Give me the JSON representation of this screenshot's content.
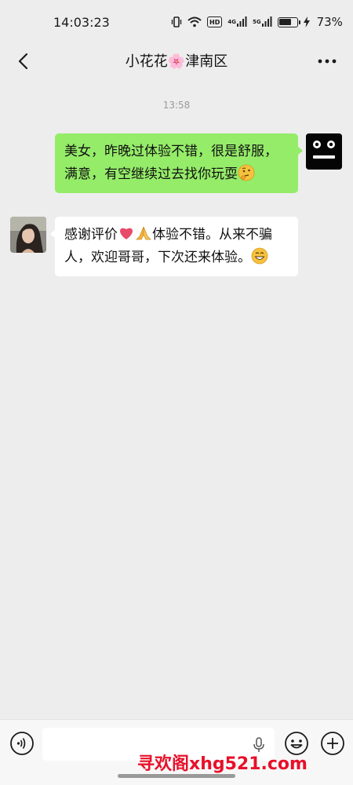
{
  "status_bar": {
    "time": "14:03:23",
    "hd_label": "HD",
    "net1_label": "4G",
    "net2_label": "5G",
    "battery_percent_text": "73%",
    "battery_level": 0.73
  },
  "header": {
    "title": "小花花🌸津南区",
    "back_icon": "chevron-left-icon",
    "more_icon": "ellipsis-icon"
  },
  "chat": {
    "timestamp": "13:58",
    "messages": [
      {
        "direction": "sent",
        "text": "美女，昨晚过体验不错，很是舒服，满意，有空继续过去找你玩耍",
        "emoji": "thinking-face-emoji"
      },
      {
        "direction": "received",
        "text_before": "感谢评价",
        "inline_emojis": [
          "red-heart-emoji",
          "folded-hands-emoji"
        ],
        "text_after": "体验不错。从来不骗人，欢迎哥哥，下次还来体验。",
        "emoji": "grinning-face-emoji"
      }
    ]
  },
  "input_bar": {
    "input_value": "",
    "voice_icon": "voice-icon",
    "mic_icon": "microphone-icon",
    "emoji_icon": "smiley-icon",
    "plus_icon": "plus-icon"
  },
  "watermark": {
    "text": "寻欢阁xhg521.com",
    "color": "#e8102a"
  },
  "colors": {
    "background": "#ededed",
    "sent_bubble": "#95ec69",
    "received_bubble": "#ffffff"
  }
}
